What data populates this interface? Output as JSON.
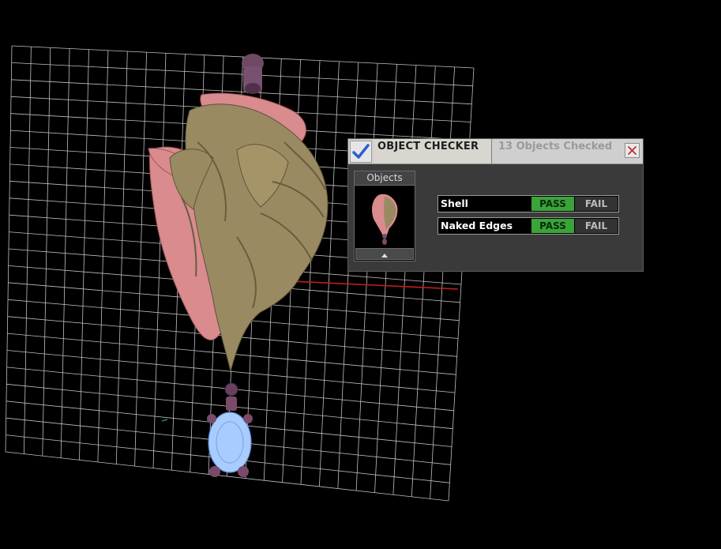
{
  "viewport": {
    "background": "#000000",
    "grid_color": "#bfbfbf",
    "axis_color": "#c0201c",
    "model_colors": {
      "gold": "#9a8a62",
      "pink": "#d98b8e",
      "gem": "#a9ccff",
      "bail": "#7a4b68"
    }
  },
  "object_checker": {
    "title": "OBJECT CHECKER",
    "count_text": "13  Objects Checked",
    "close_icon": "close-icon",
    "objects_label": "Objects",
    "scroll_icon": "triangle-up-icon",
    "checks": [
      {
        "label": "Shell",
        "pass": "PASS",
        "fail": "FAIL",
        "state": "pass"
      },
      {
        "label": "Naked Edges",
        "pass": "PASS",
        "fail": "FAIL",
        "state": "pass"
      }
    ],
    "colors": {
      "pass": "#3aa43a",
      "fail": "#333333",
      "title_bg": "#cfcfcf",
      "panel_bg": "#3a3a3a"
    }
  }
}
